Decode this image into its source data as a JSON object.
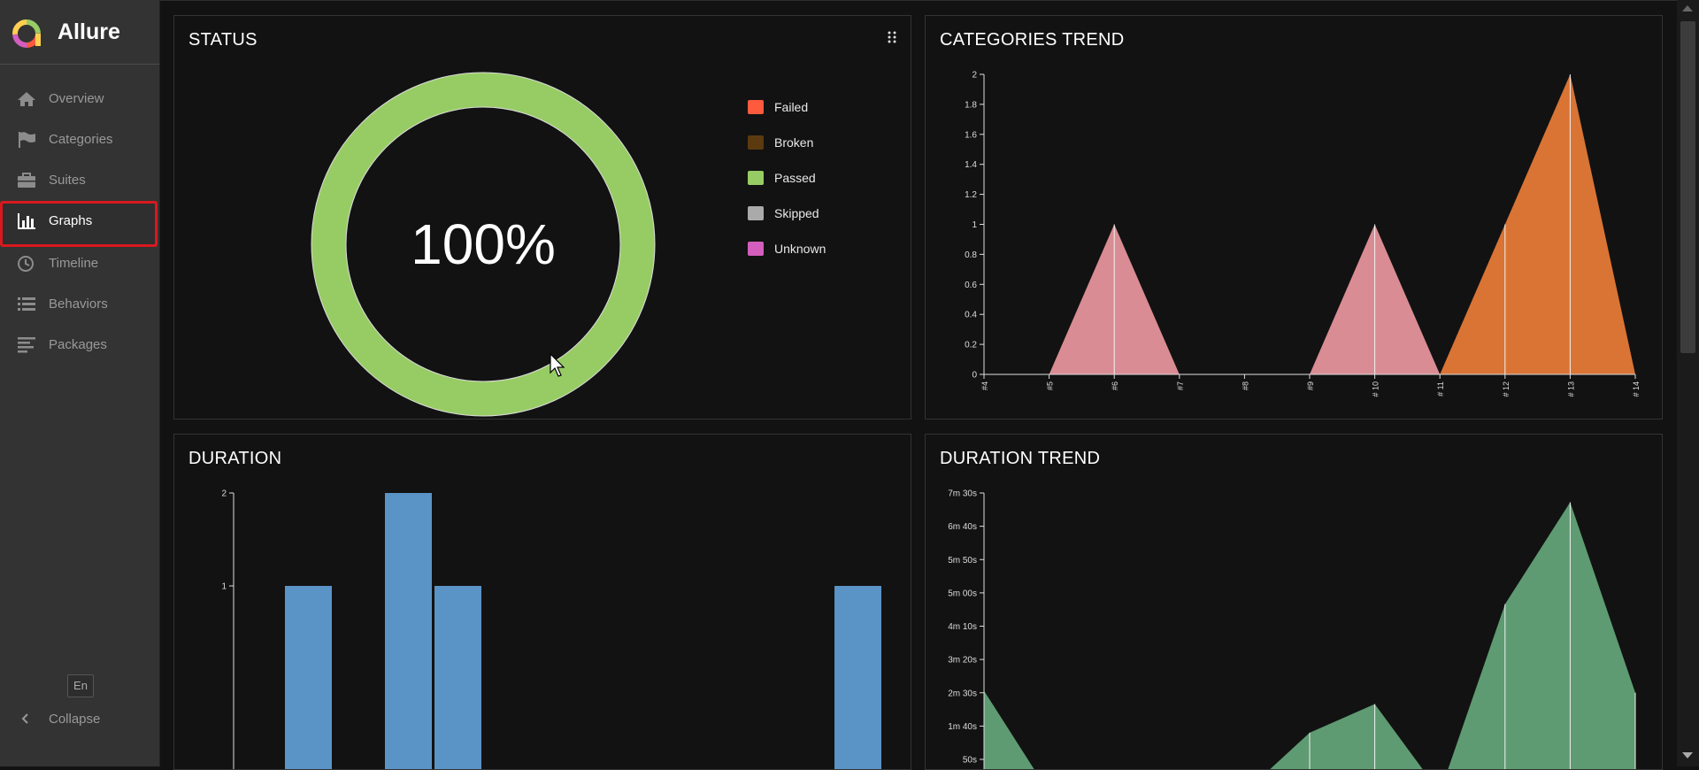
{
  "app": {
    "name": "Allure"
  },
  "sidebar": {
    "items": [
      {
        "label": "Overview",
        "icon": "home-icon"
      },
      {
        "label": "Categories",
        "icon": "flag-icon"
      },
      {
        "label": "Suites",
        "icon": "briefcase-icon"
      },
      {
        "label": "Graphs",
        "icon": "bar-chart-icon",
        "active": true
      },
      {
        "label": "Timeline",
        "icon": "clock-icon"
      },
      {
        "label": "Behaviors",
        "icon": "list-icon"
      },
      {
        "label": "Packages",
        "icon": "align-left-icon"
      }
    ],
    "language": "En",
    "collapse_label": "Collapse"
  },
  "widgets": {
    "status": {
      "title": "STATUS",
      "center_text": "100%",
      "legend": [
        {
          "label": "Failed",
          "color": "#fd5a3e"
        },
        {
          "label": "Broken",
          "color": "#5c3a0f"
        },
        {
          "label": "Passed",
          "color": "#97cc64"
        },
        {
          "label": "Skipped",
          "color": "#aaaaaa"
        },
        {
          "label": "Unknown",
          "color": "#d35ebe"
        }
      ]
    },
    "categories_trend": {
      "title": "CATEGORIES TREND"
    },
    "duration": {
      "title": "DURATION"
    },
    "duration_trend": {
      "title": "DURATION TREND"
    }
  },
  "chart_data": [
    {
      "type": "pie",
      "id": "status",
      "slices": [
        {
          "label": "Passed",
          "value": 100,
          "color": "#97cc64"
        }
      ],
      "center_label": "100%"
    },
    {
      "type": "area",
      "id": "categories_trend",
      "x": [
        "#4",
        "#5",
        "#6",
        "#7",
        "#8",
        "#9",
        "# 10",
        "# 11",
        "# 12",
        "# 13",
        "# 14"
      ],
      "series": [
        {
          "color": "#d98c93",
          "values": [
            0,
            0,
            1,
            0,
            0,
            0,
            1,
            0,
            0,
            0,
            0
          ]
        },
        {
          "color": "#d97435",
          "values": [
            0,
            0,
            0,
            0,
            0,
            0,
            0,
            0,
            1,
            2,
            0
          ]
        }
      ],
      "ylim": [
        0,
        2
      ],
      "yticks": [
        "0",
        "0.2",
        "0.4",
        "0.6",
        "0.8",
        "1",
        "1.2",
        "1.4",
        "1.6",
        "1.8",
        "2"
      ]
    },
    {
      "type": "bar",
      "id": "duration",
      "values": [
        1,
        2,
        1,
        1
      ],
      "bar_color": "#5a93c6",
      "ylim": [
        0,
        2
      ],
      "yticks": [
        "1",
        "2"
      ]
    },
    {
      "type": "area",
      "id": "duration_trend",
      "color": "#5e9b72",
      "yticks": [
        "50s",
        "1m 40s",
        "2m 30s",
        "3m 20s",
        "4m 10s",
        "5m 00s",
        "5m 50s",
        "6m 40s",
        "7m 30s"
      ],
      "values_seconds": [
        153,
        0,
        0,
        0,
        0,
        90,
        133,
        0,
        283,
        436,
        150
      ],
      "ylim_seconds": [
        50,
        450
      ]
    }
  ]
}
